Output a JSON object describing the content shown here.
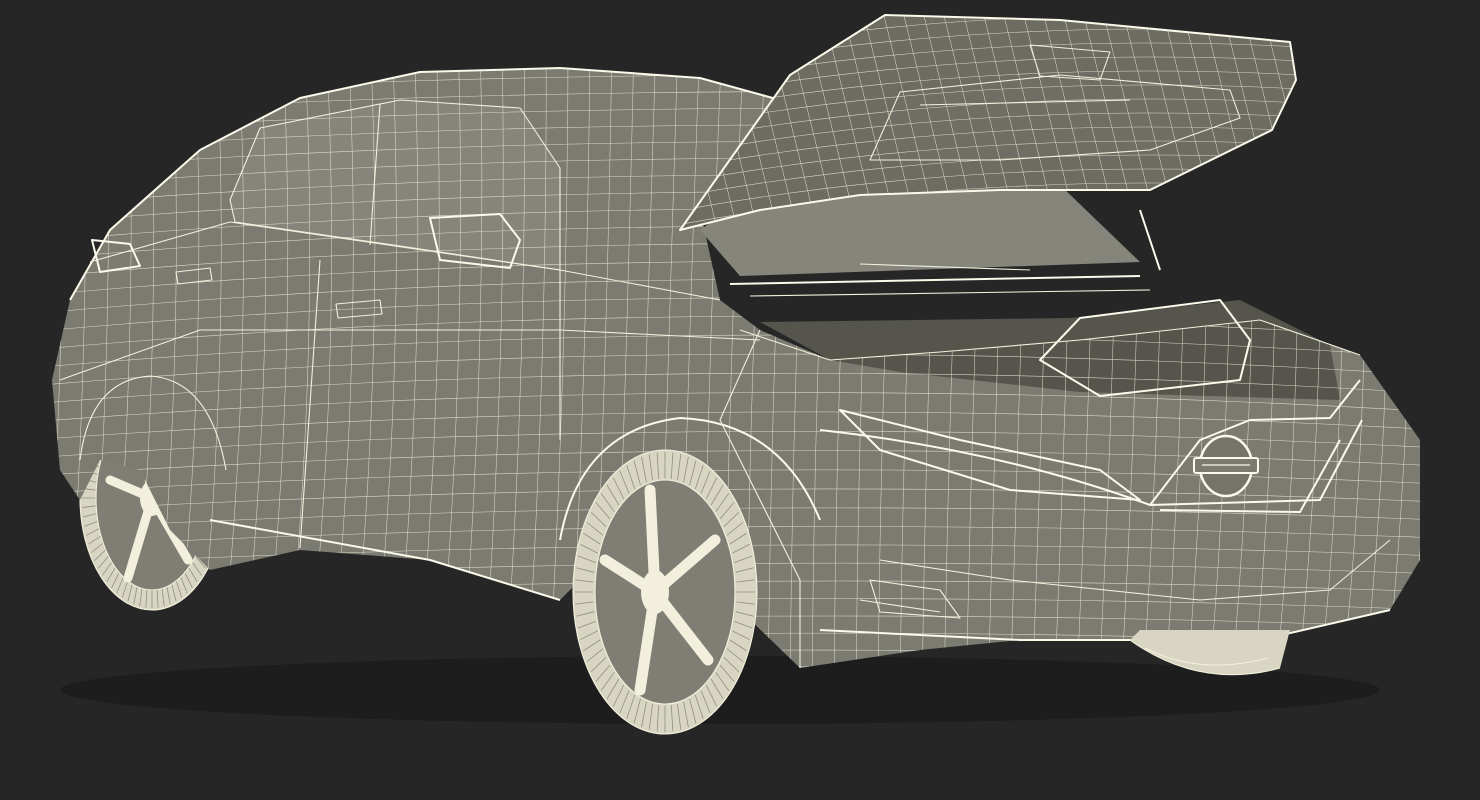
{
  "scene": {
    "subject": "electric-hatchback-wireframe",
    "hood_state": "open",
    "colors": {
      "background": "#262626",
      "wire": "#f2f0dc",
      "surface": "#7b7b72",
      "surface_dark": "#6c6c63",
      "tire": "#d8d6c2"
    }
  }
}
